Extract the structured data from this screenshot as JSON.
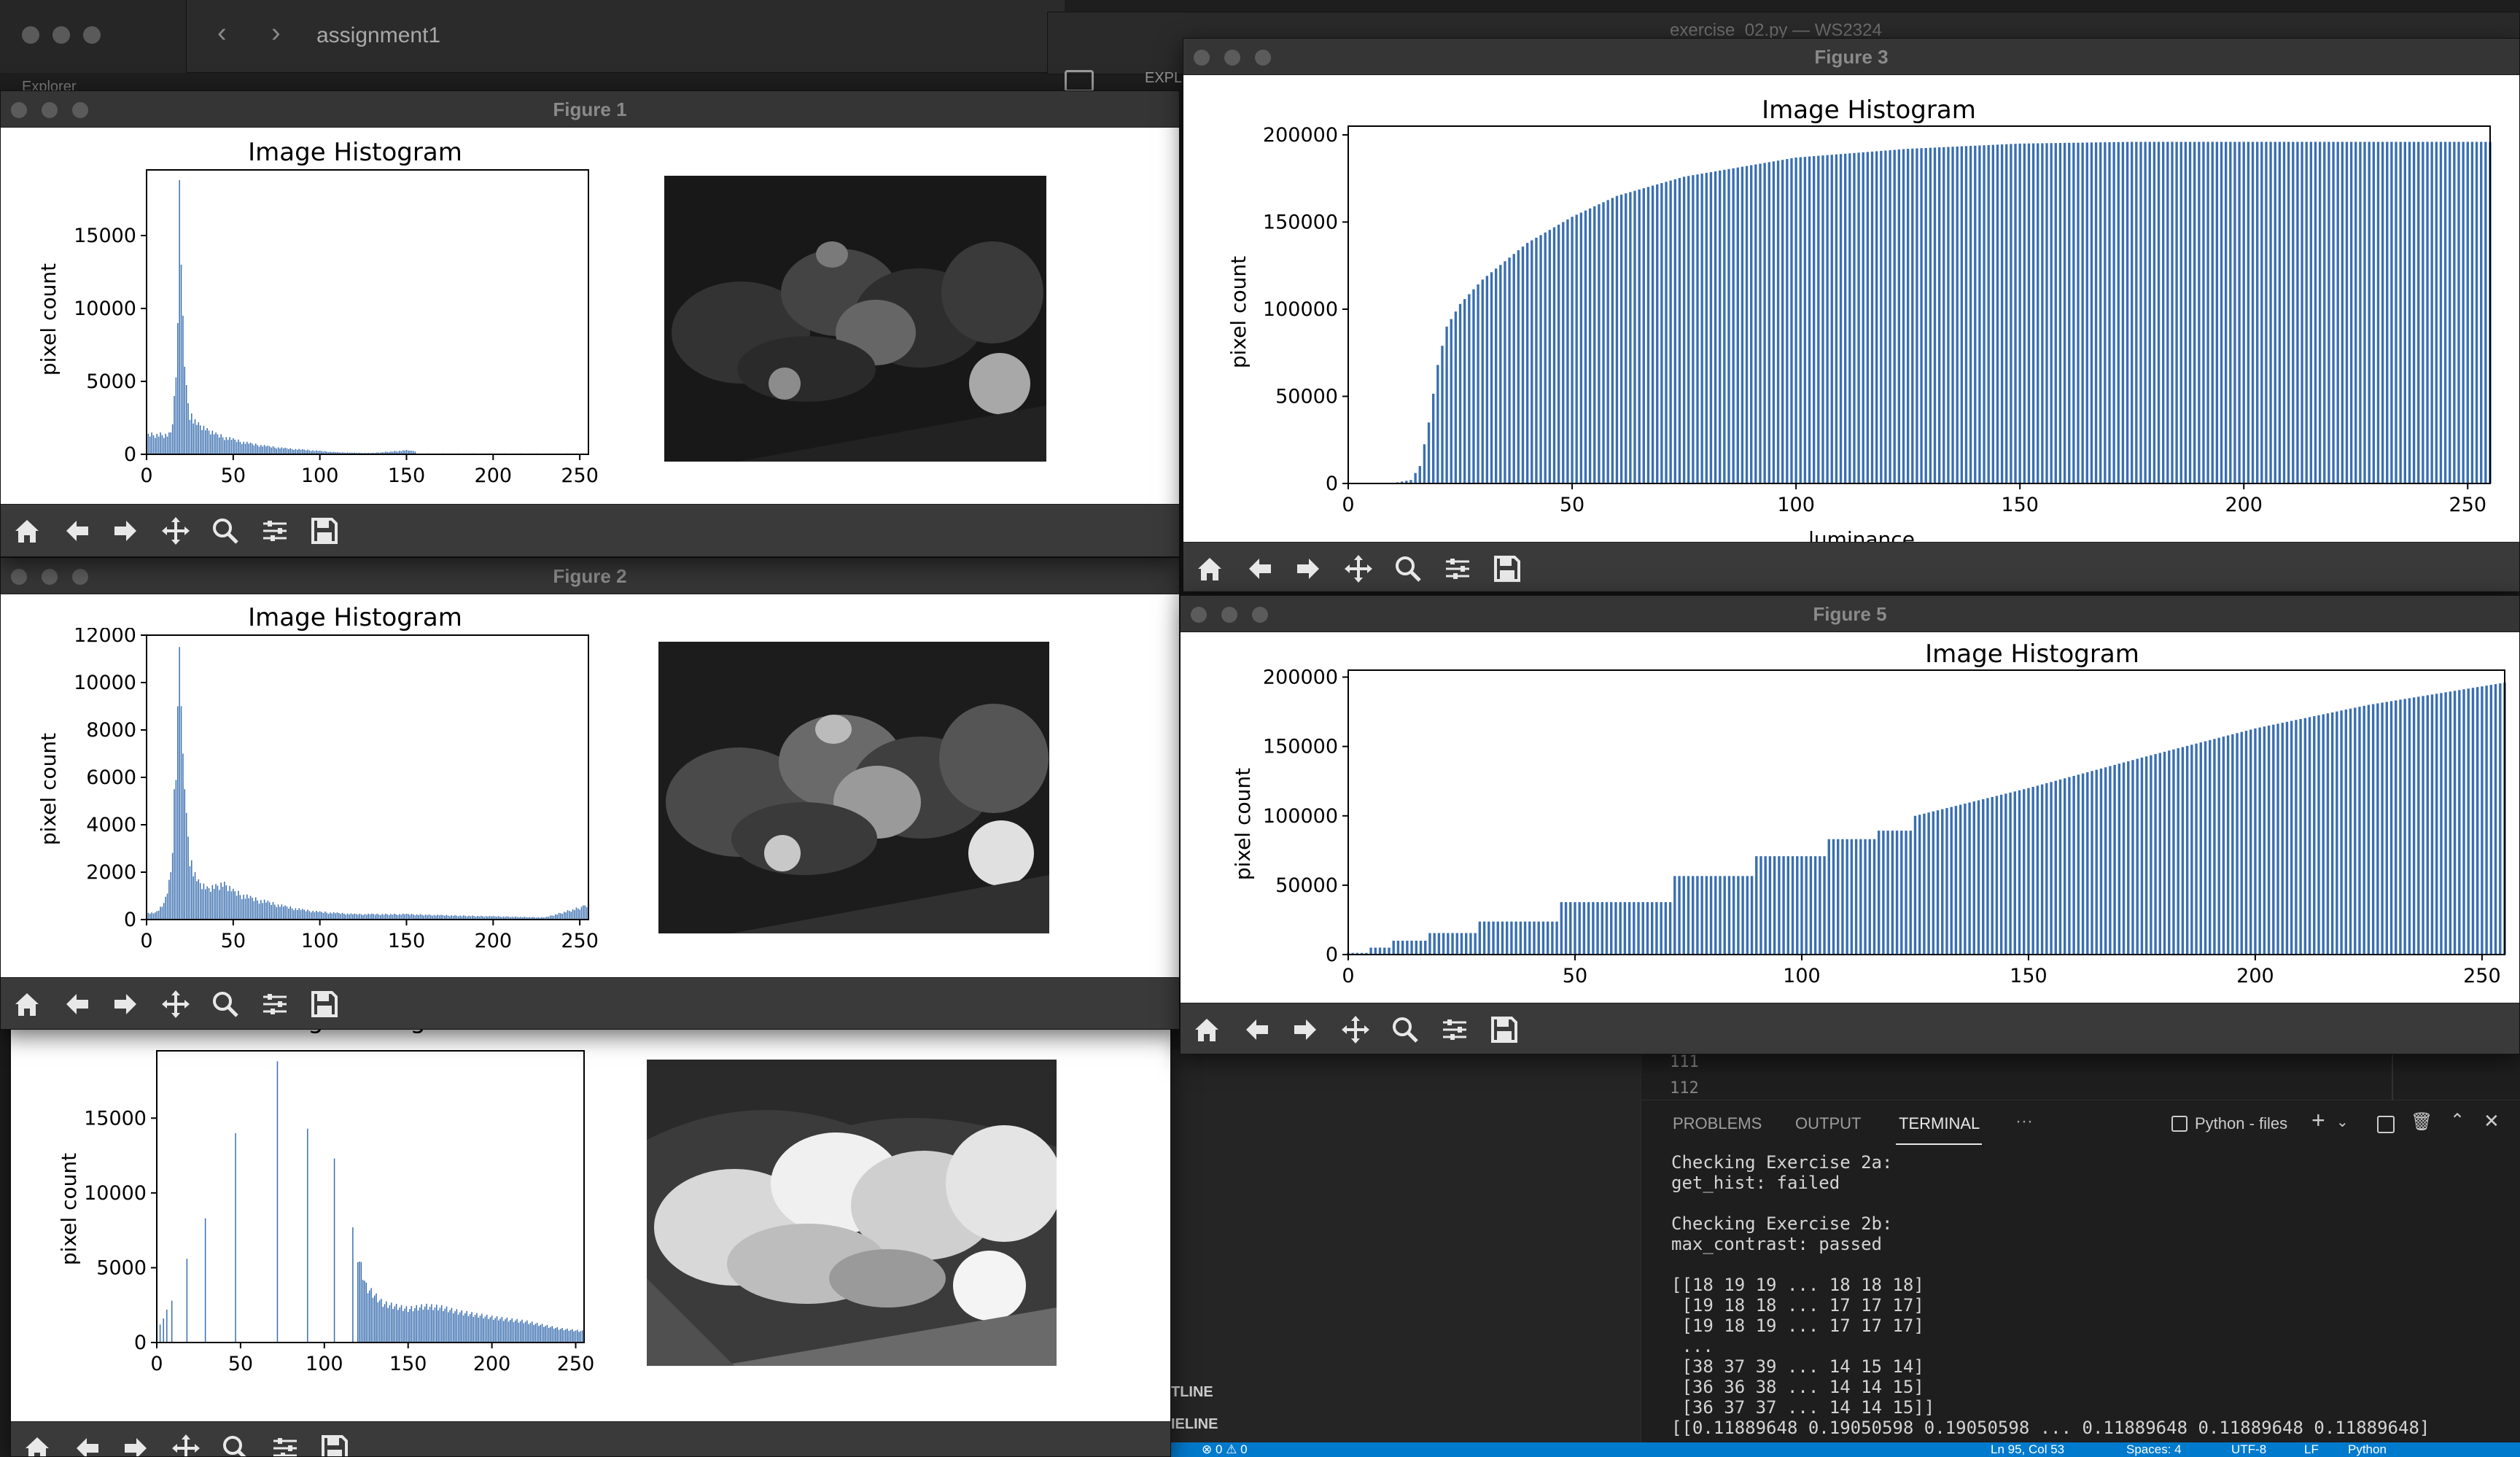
{
  "ide": {
    "breadcrumb": "assignment1",
    "explorer_label": "Explorer",
    "editor_window_title": "exercise_02.py — WS2324",
    "explorer_tab_partial": "EXPL",
    "line_numbers": [
      "111",
      "112"
    ],
    "panel_tabs": [
      "PROBLEMS",
      "OUTPUT",
      "TERMINAL",
      "···"
    ],
    "terminal_profile": "Python - files",
    "outline_label": "TLINE",
    "timeline_label": "IELINE",
    "terminal_lines": [
      "Checking Exercise 2a:",
      "get_hist: failed",
      "",
      "Checking Exercise 2b:",
      "max_contrast: passed",
      "",
      "[[18 19 19 ... 18 18 18]",
      " [19 18 18 ... 17 17 17]",
      " [19 18 19 ... 17 17 17]",
      " ...",
      " [38 37 39 ... 14 15 14]",
      " [36 36 38 ... 14 14 15]",
      " [36 37 37 ... 14 14 15]]",
      "[[0.11889648 0.19050598 0.19050598 ... 0.11889648 0.11889648 0.11889648]"
    ],
    "status_bar": {
      "left": "⊗ 0 ⚠ 0",
      "position": "Ln 95, Col 53",
      "spaces": "Spaces: 4",
      "encoding": "UTF-8",
      "eol": "LF",
      "language": "Python"
    }
  },
  "figures": {
    "fig1": {
      "title": "Figure 1",
      "plot_title": "Image Histogram",
      "ylabel": "pixel count"
    },
    "fig2": {
      "title": "Figure 2",
      "plot_title": "Image Histogram",
      "ylabel": "pixel count"
    },
    "fig3": {
      "title": "Figure 3",
      "plot_title": "Image Histogram",
      "ylabel": "pixel count",
      "xlabel": "luminance"
    },
    "fig4": {
      "title": "",
      "plot_title": "Image Histogram",
      "ylabel": "pixel count"
    },
    "fig5": {
      "title": "Figure 5",
      "plot_title": "Image Histogram",
      "ylabel": "pixel count"
    }
  },
  "toolbar_icons": [
    "home-icon",
    "back-arrow-icon",
    "forward-arrow-icon",
    "pan-move-icon",
    "zoom-icon",
    "configure-subplots-icon",
    "save-icon"
  ],
  "colors": {
    "bar": "#3a6fb0",
    "ide_bg": "#1e1e1e",
    "status_bar": "#007acc"
  },
  "chart_data": [
    {
      "figure": "Figure 1",
      "type": "bar",
      "title": "Image Histogram",
      "xlabel": "",
      "ylabel": "pixel count",
      "xlim": [
        0,
        255
      ],
      "ylim": [
        0,
        19500
      ],
      "xticks": [
        0,
        50,
        100,
        150,
        200,
        250
      ],
      "yticks": [
        0,
        5000,
        10000,
        15000
      ],
      "series": [
        {
          "x": [
            14,
            16,
            18,
            19,
            20,
            21,
            22,
            24,
            26,
            28,
            30,
            35,
            40,
            50,
            60,
            70,
            80,
            90,
            100,
            110,
            120,
            130,
            150,
            152
          ],
          "values": [
            1500,
            4000,
            9000,
            18800,
            13000,
            9500,
            6000,
            3500,
            2800,
            2400,
            2200,
            1800,
            1500,
            1100,
            800,
            600,
            450,
            350,
            250,
            150,
            120,
            100,
            300,
            250
          ]
        }
      ]
    },
    {
      "figure": "Figure 2",
      "type": "bar",
      "title": "Image Histogram",
      "xlabel": "",
      "ylabel": "pixel count",
      "xlim": [
        0,
        255
      ],
      "ylim": [
        0,
        12000
      ],
      "xticks": [
        0,
        50,
        100,
        150,
        200,
        250
      ],
      "yticks": [
        0,
        2000,
        4000,
        6000,
        8000,
        10000,
        12000
      ],
      "series": [
        {
          "x": [
            5,
            10,
            14,
            16,
            18,
            19,
            20,
            21,
            22,
            24,
            26,
            28,
            30,
            35,
            40,
            45,
            50,
            60,
            70,
            80,
            90,
            100,
            110,
            120,
            130,
            150,
            170,
            200,
            230,
            252
          ],
          "values": [
            300,
            700,
            2000,
            5500,
            9000,
            11500,
            9000,
            7000,
            5500,
            3500,
            2500,
            2000,
            1700,
            1400,
            1500,
            1600,
            1300,
            1000,
            800,
            600,
            450,
            350,
            300,
            250,
            250,
            250,
            200,
            150,
            100,
            600
          ]
        }
      ]
    },
    {
      "figure": "Figure 3",
      "type": "bar",
      "title": "Image Histogram",
      "xlabel": "luminance",
      "ylabel": "pixel count",
      "xlim": [
        0,
        255
      ],
      "ylim": [
        0,
        205000
      ],
      "xticks": [
        0,
        50,
        100,
        150,
        200,
        250
      ],
      "yticks": [
        0,
        50000,
        100000,
        150000,
        200000
      ],
      "series": [
        {
          "x": [
            0,
            10,
            14,
            16,
            18,
            20,
            22,
            25,
            30,
            40,
            50,
            60,
            75,
            100,
            125,
            150,
            175,
            200,
            225,
            255
          ],
          "values": [
            0,
            200,
            2000,
            10000,
            35000,
            68000,
            90000,
            103000,
            117000,
            138000,
            153000,
            165000,
            176000,
            187000,
            192000,
            195000,
            196000,
            196000,
            196000,
            196000
          ]
        }
      ]
    },
    {
      "figure": "Figure 4",
      "type": "bar",
      "title": "Image Histogram",
      "xlabel": "",
      "ylabel": "pixel count",
      "xlim": [
        0,
        255
      ],
      "ylim": [
        0,
        19500
      ],
      "xticks": [
        0,
        50,
        100,
        150,
        200,
        250
      ],
      "yticks": [
        0,
        5000,
        10000,
        15000
      ],
      "series": [
        {
          "x": [
            2,
            4,
            6,
            9,
            18,
            29,
            47,
            72,
            90,
            106,
            117,
            125,
            135,
            150,
            160,
            170,
            180,
            200,
            220,
            240,
            255
          ],
          "values": [
            1200,
            1600,
            2200,
            2800,
            5600,
            8300,
            14000,
            18800,
            14300,
            12300,
            7700,
            4000,
            2800,
            2400,
            2600,
            2500,
            2200,
            1800,
            1500,
            1000,
            800
          ]
        }
      ]
    },
    {
      "figure": "Figure 5",
      "type": "bar",
      "title": "Image Histogram",
      "xlabel": "",
      "ylabel": "pixel count",
      "xlim": [
        0,
        255
      ],
      "ylim": [
        0,
        205000
      ],
      "xticks": [
        0,
        50,
        100,
        150,
        200,
        250
      ],
      "yticks": [
        0,
        50000,
        100000,
        150000,
        200000
      ],
      "series": [
        {
          "x": [
            0,
            5,
            10,
            18,
            29,
            47,
            72,
            90,
            106,
            117,
            125,
            150,
            175,
            200,
            225,
            255
          ],
          "values": [
            1200,
            5000,
            10000,
            15500,
            23800,
            37800,
            56600,
            70900,
            83200,
            89300,
            100000,
            120000,
            142000,
            163000,
            180000,
            196000
          ]
        }
      ]
    }
  ]
}
